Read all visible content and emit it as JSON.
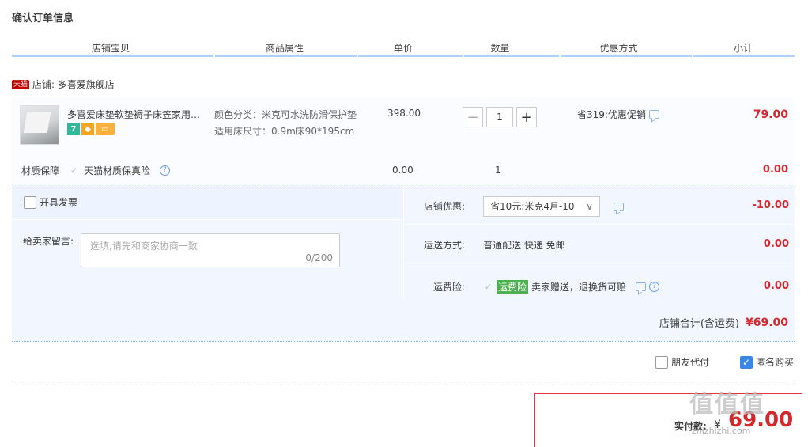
{
  "page": {
    "title": "确认订单信息"
  },
  "columns": {
    "shop_item": "店铺宝贝",
    "attributes": "商品属性",
    "unit_price": "单价",
    "quantity": "数量",
    "discount": "优惠方式",
    "subtotal": "小计"
  },
  "shop": {
    "badge": "天猫",
    "label": "店铺: 多喜爱旗舰店"
  },
  "item": {
    "title": "多喜爱床垫软垫褥子床笠家用保护垫",
    "tag_seven": "7",
    "attr_color": "颜色分类：米克可水洗防滑保护垫",
    "attr_size": "适用床尺寸：0.9m床90*195cm",
    "price": "398.00",
    "qty": "1",
    "qty_minus": "−",
    "qty_plus": "+",
    "promo": "省319:优惠促销",
    "subtotal": "79.00"
  },
  "insurance": {
    "label": "材质保障",
    "check": "✓",
    "name": "天猫材质保真险",
    "help": "?",
    "price": "0.00",
    "qty": "1",
    "subtotal": "0.00"
  },
  "invoice": {
    "label": "开具发票"
  },
  "memo": {
    "label": "给卖家留言:",
    "placeholder": "选填,请先和商家协商一致",
    "counter": "0/200"
  },
  "shop_discount": {
    "label": "店铺优惠:",
    "selected": "省10元:米克4月-10",
    "chevron": "∨",
    "amount": "-10.00"
  },
  "shipping": {
    "label": "运送方式:",
    "value": "普通配送 快递 免邮",
    "amount": "0.00"
  },
  "freight_ins": {
    "label": "运费险:",
    "check": "✓",
    "tag": "运费险",
    "desc": "卖家赠送，退换货可赔",
    "help": "?",
    "amount": "0.00"
  },
  "shop_total": {
    "label": "店铺合计(含运费)",
    "amount": "¥69.00"
  },
  "extras": {
    "friend_pay": "朋友代付",
    "anonymous": "匿名购买",
    "anon_check": "✓"
  },
  "payment": {
    "label": "实付款:",
    "symbol": "¥",
    "amount": "69.00"
  },
  "watermark": {
    "main": "值值值",
    "sub": "zhizhizhi.com"
  }
}
